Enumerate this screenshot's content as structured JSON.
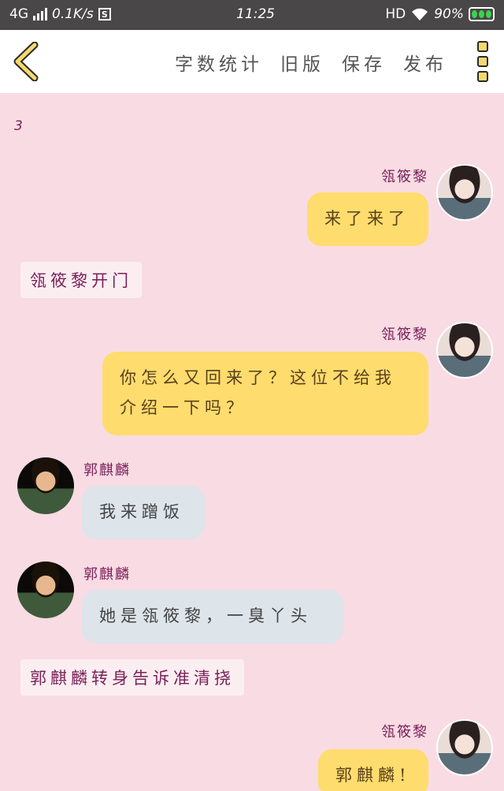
{
  "status_bar": {
    "network": "4G",
    "speed": "0.1K/s",
    "s_badge": "S",
    "time": "11:25",
    "hd": "HD",
    "battery": "90%"
  },
  "toolbar": {
    "word_count": "字数统计",
    "old_version": "旧版",
    "save": "保存",
    "publish": "发布"
  },
  "chat": {
    "page_number": "3",
    "messages": [
      {
        "speaker": "瓴筱黎",
        "text": "来了来了"
      },
      {
        "narration": "瓴筱黎开门"
      },
      {
        "speaker": "瓴筱黎",
        "text": "你怎么又回来了？这位不给我介绍一下吗？"
      },
      {
        "speaker": "郭麒麟",
        "text": "我来蹭饭"
      },
      {
        "speaker": "郭麒麟",
        "text": "她是瓴筱黎，一臭丫头"
      },
      {
        "narration": "郭麒麟转身告诉准清挠"
      },
      {
        "speaker": "瓴筱黎",
        "text": "郭麒麟!"
      }
    ]
  },
  "colors": {
    "background": "#f9dbe4",
    "bubble_right": "#fedc6e",
    "bubble_left": "#dde4ea",
    "name_color": "#7a2058"
  }
}
